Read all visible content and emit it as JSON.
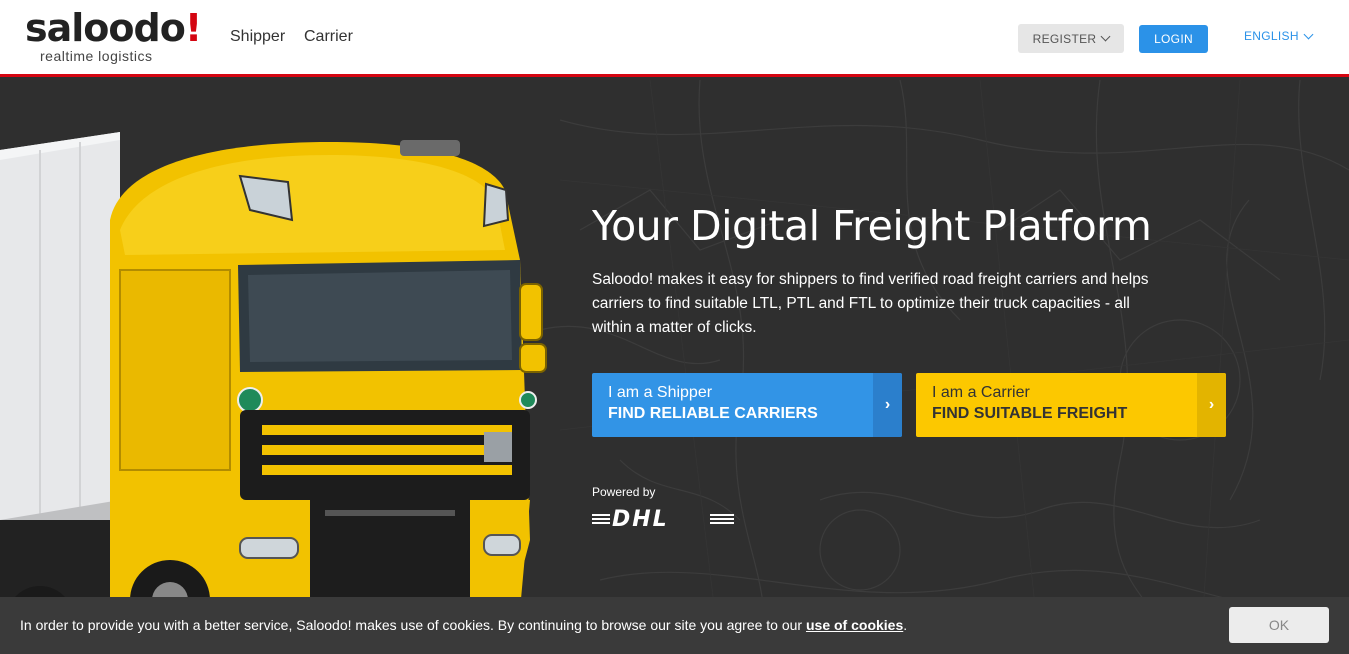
{
  "header": {
    "logo_main": "saloodo",
    "logo_accent": "!",
    "logo_tagline": "realtime logistics",
    "nav": [
      "Shipper",
      "Carrier"
    ],
    "register_label": "REGISTER",
    "login_label": "LOGIN",
    "language_label": "ENGLISH",
    "accent_color": "#d40511"
  },
  "hero": {
    "title": "Your Digital Freight Platform",
    "description": "Saloodo! makes it easy for shippers to find verified road freight carriers and helps carriers to find suitable LTL, PTL and FTL to optimize their truck capacities - all within a matter of clicks.",
    "cta_shipper": {
      "line1": "I am a Shipper",
      "line2": "FIND RELIABLE CARRIERS",
      "color": "#3294e6"
    },
    "cta_carrier": {
      "line1": "I am a Carrier",
      "line2": "FIND SUITABLE FREIGHT",
      "color": "#fcc800"
    },
    "powered_by": "Powered by",
    "partner_logo": "DHL"
  },
  "cookie": {
    "text": "In order to provide you with a better service, Saloodo! makes use of cookies. By continuing to browse our site you agree to our ",
    "link_label": "use of cookies",
    "suffix": ".",
    "ok_label": "OK"
  }
}
